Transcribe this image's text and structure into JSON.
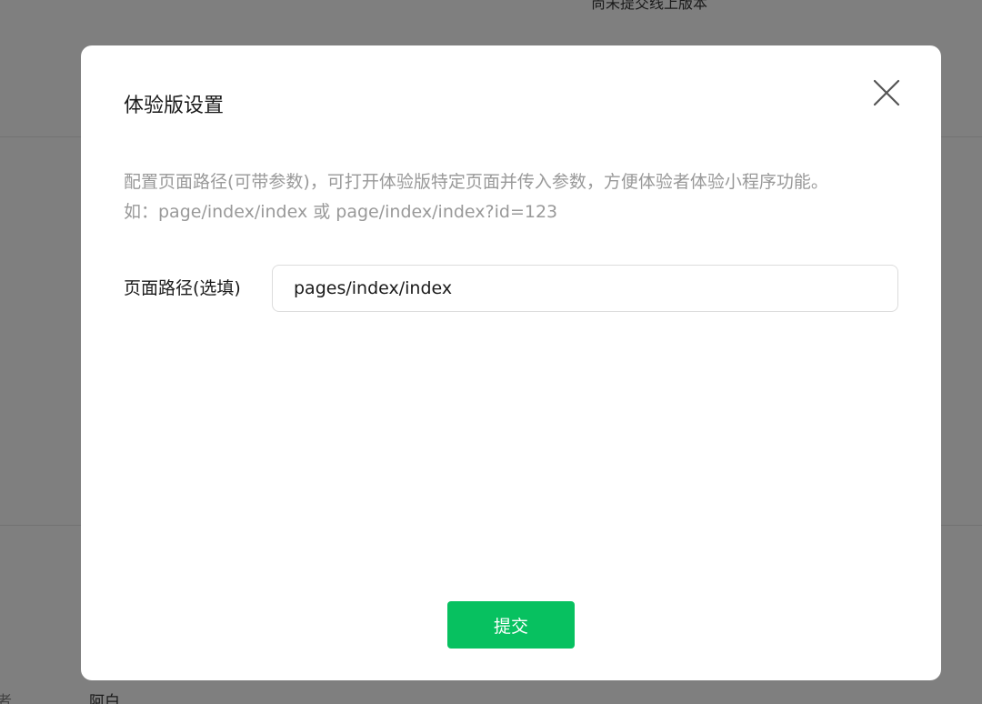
{
  "background": {
    "top_text": "尚未提交线上版本",
    "bottom_label": "者",
    "bottom_value": "阿白"
  },
  "dialog": {
    "title": "体验版设置",
    "close_icon": "close-icon",
    "description_lines": [
      "配置页面路径(可带参数)，可打开体验版特定页面并传入参数，方便体验者体验小程序功能。",
      "如：page/index/index 或 page/index/index?id=123"
    ],
    "path_field": {
      "label": "页面路径(选填)",
      "value": "pages/index/index"
    },
    "submit_label": "提交"
  },
  "colors": {
    "accent": "#07c160",
    "mask": "rgba(0,0,0,0.5)",
    "muted_text": "#999999"
  }
}
